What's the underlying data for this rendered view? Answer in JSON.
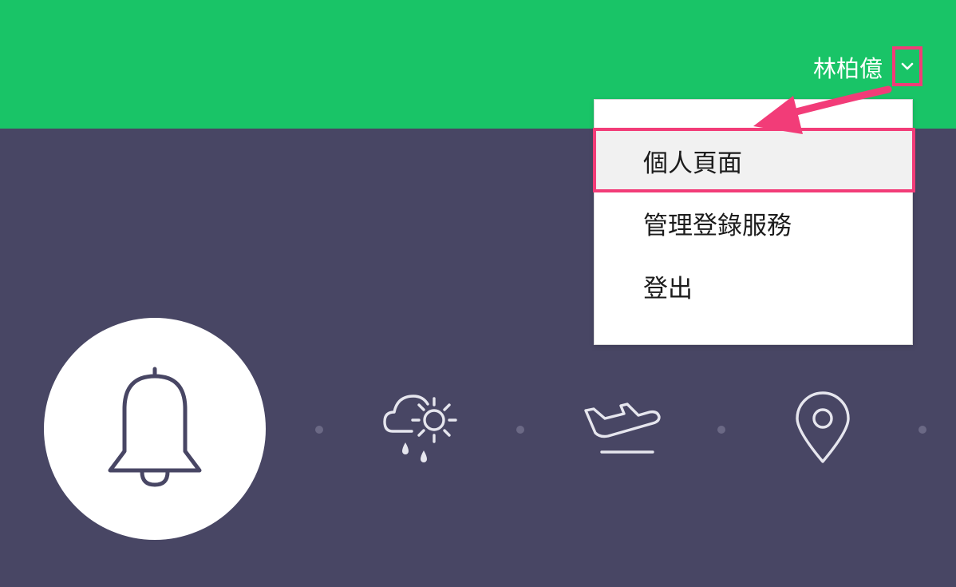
{
  "header": {
    "user_name": "林柏億",
    "dropdown_icon": "chevron-down-icon"
  },
  "menu": {
    "items": [
      {
        "label": "個人頁面",
        "active": true
      },
      {
        "label": "管理登錄服務",
        "active": false
      },
      {
        "label": "登出",
        "active": false
      }
    ]
  },
  "features": {
    "icons": [
      "bell-icon",
      "weather-icon",
      "flight-departure-icon",
      "location-pin-icon"
    ]
  },
  "colors": {
    "header_bg": "#19c467",
    "page_bg": "#484664",
    "highlight": "#f23c78",
    "icon_line": "#e6e6ee"
  }
}
